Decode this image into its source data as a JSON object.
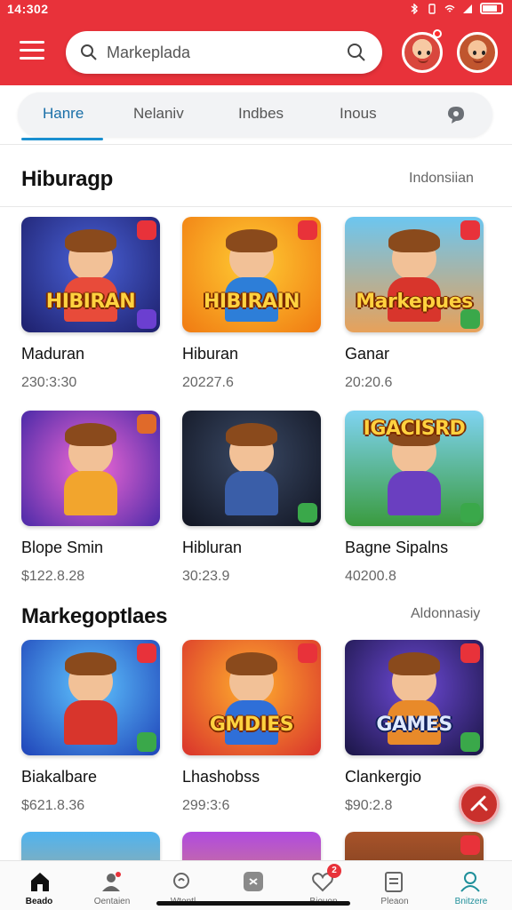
{
  "status_bar": {
    "time": "14:302"
  },
  "header": {
    "search_placeholder": "Markeplada",
    "colors": {
      "brand": "#e8323a",
      "accent": "#1a8fd0"
    }
  },
  "tabs": [
    {
      "label": "Hanre",
      "active": true
    },
    {
      "label": "Nelaniv",
      "active": false
    },
    {
      "label": "Indbes",
      "active": false
    },
    {
      "label": "Inous",
      "active": false
    }
  ],
  "sections": [
    {
      "title": "Hiburagp",
      "link": "Indonsiian",
      "cards": [
        {
          "name": "Maduran",
          "price": "230:3:30",
          "logo": "HIBIRAN",
          "palette": "purple"
        },
        {
          "name": "Hiburan",
          "price": "20227.6",
          "logo": "HIBIRAIN",
          "palette": "orange"
        },
        {
          "name": "Ganar",
          "price": "20:20.6",
          "logo": "Markepues",
          "palette": "city"
        },
        {
          "name": "Blope Smin",
          "price": "$122.8.28",
          "logo": "",
          "palette": "magenta"
        },
        {
          "name": "Hibluran",
          "price": "30:23.9",
          "logo": "",
          "palette": "dark"
        },
        {
          "name": "Bagne Sipalns",
          "price": "40200.8",
          "logo": "IGACISRD",
          "palette": "green"
        }
      ]
    },
    {
      "title": "Markegoptlaes",
      "link": "Aldonnasiy",
      "cards": [
        {
          "name": "Biakalbare",
          "price": "$621.8.36",
          "logo": "",
          "palette": "blue"
        },
        {
          "name": "Lhashobss",
          "price": "299:3:6",
          "logo": "GMDIES",
          "palette": "sunset"
        },
        {
          "name": "Clankergio",
          "price": "$90:2.8",
          "logo": "GAMES",
          "palette": "night"
        }
      ]
    }
  ],
  "bottom_nav": [
    {
      "label": "Beado",
      "icon": "home-icon",
      "active": true
    },
    {
      "label": "Oentaien",
      "icon": "profile-icon",
      "active": false
    },
    {
      "label": "Wtontl",
      "icon": "search-icon",
      "active": false
    },
    {
      "label": "",
      "icon": "game-controller-icon",
      "active": false
    },
    {
      "label": "Biouon",
      "icon": "heart-icon",
      "active": false,
      "badge": "2"
    },
    {
      "label": "Pleaon",
      "icon": "document-icon",
      "active": false
    },
    {
      "label": "Bnitzere",
      "icon": "user-icon",
      "active": false
    }
  ]
}
